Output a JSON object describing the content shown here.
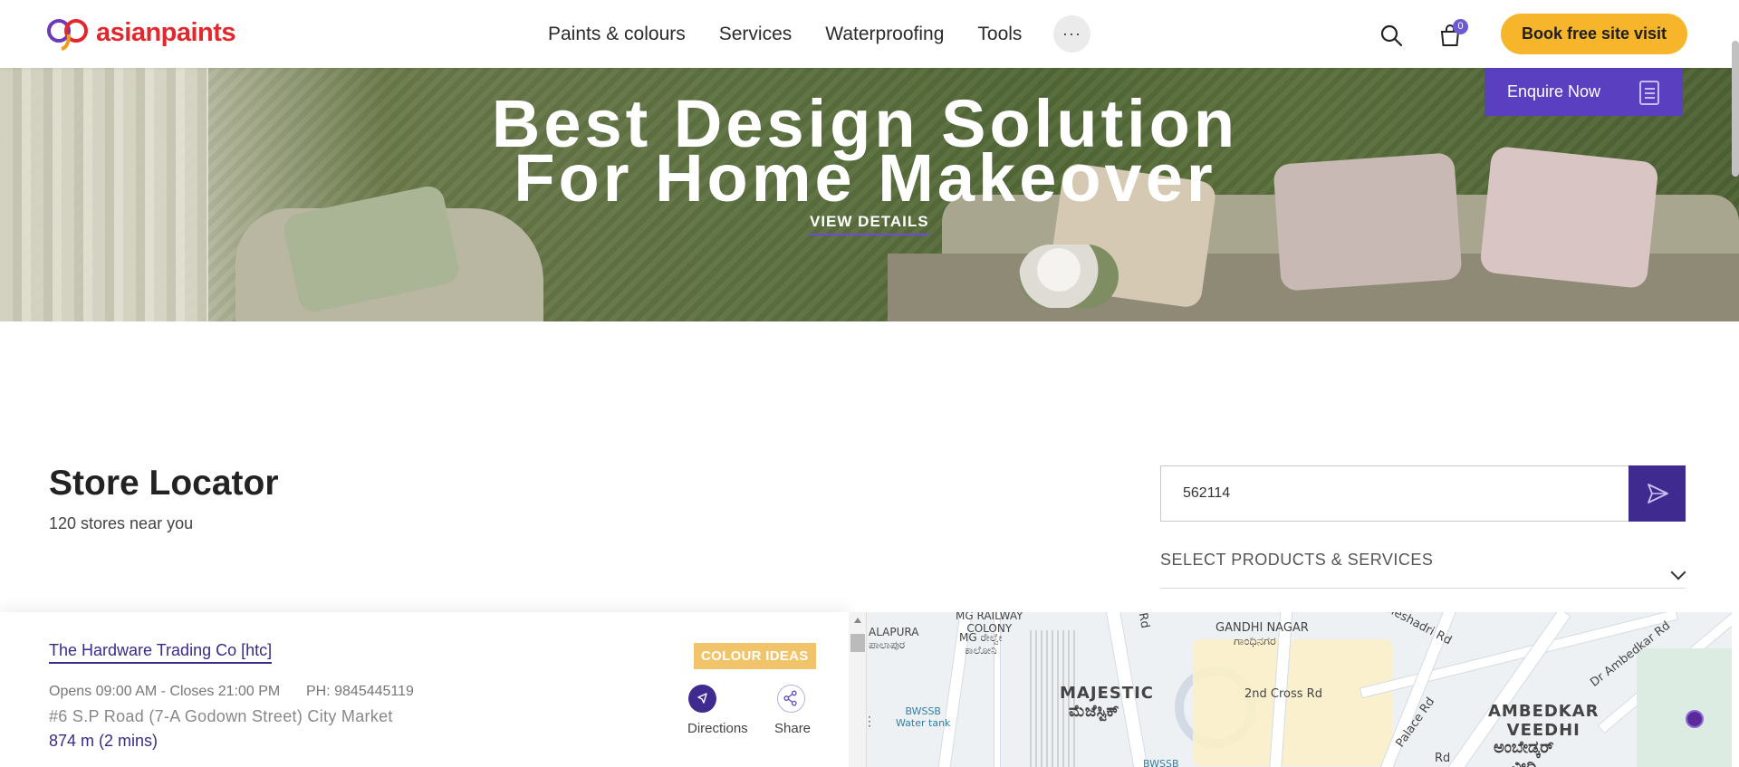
{
  "header": {
    "logo_text": "asianpaints",
    "nav": [
      "Paints & colours",
      "Services",
      "Waterproofing",
      "Tools"
    ],
    "more_label": "···",
    "cart_count": "0",
    "book_label": "Book free site visit",
    "icons": {
      "search": "search-icon",
      "cart": "shopping-bag-icon",
      "more": "ellipsis-icon"
    }
  },
  "hero": {
    "title_line1": "Best Design Solution",
    "title_line2": "For Home Makeover",
    "cta": "VIEW DETAILS",
    "enquire_label": "Enquire Now"
  },
  "store_locator": {
    "title": "Store Locator",
    "count_text": "120 stores near you",
    "pincode_value": "562114",
    "select_label": "SELECT PRODUCTS & SERVICES"
  },
  "store": {
    "name": "The Hardware Trading Co [htc]",
    "badge": "COLOUR IDEAS",
    "hours": "Opens 09:00 AM - Closes 21:00 PM",
    "phone": "PH: 9845445119",
    "address": "#6 S.P Road (7-A Godown Street) City Market",
    "distance": "874 m (2 mins)",
    "directions_label": "Directions",
    "share_label": "Share"
  },
  "map": {
    "labels": {
      "alapura": "ALAPURA",
      "alapura_kn": "ಪಾಲಾಪುರ",
      "railway": "MG RAILWAY\nCOLONY",
      "railway_kn": "MG ರೇಲ್ವೇ\nಕಾಲೋನಿ",
      "gandhinagar": "GANDHI NAGAR",
      "gandhinagar_kn": "ಗಾಂಧಿನಗರ",
      "majestic": "MAJESTIC",
      "majestic_kn": "ಮೆಜೆಸ್ಟಿಕ್",
      "bwssb": "BWSSB\nWater tank",
      "bwssb2": "BWSSB",
      "cross": "2nd Cross Rd",
      "palace": "Palace Rd",
      "ambedkar": "AMBEDKAR\nVEEDHI",
      "ambedkar_kn": "ಅಂಬೇಡ್ಕರ್\nವೀಧಿ",
      "dr_ambedkar": "Dr Ambedkar Rd",
      "sheshadri": "Sheshadri Rd",
      "rd": "Rd",
      "rd2": "Rd"
    }
  },
  "colors": {
    "brand_red": "#e2282d",
    "accent_purple": "#3f2a8f",
    "cta_yellow": "#f7b52b",
    "enquire_purple": "#5a3fc0"
  }
}
